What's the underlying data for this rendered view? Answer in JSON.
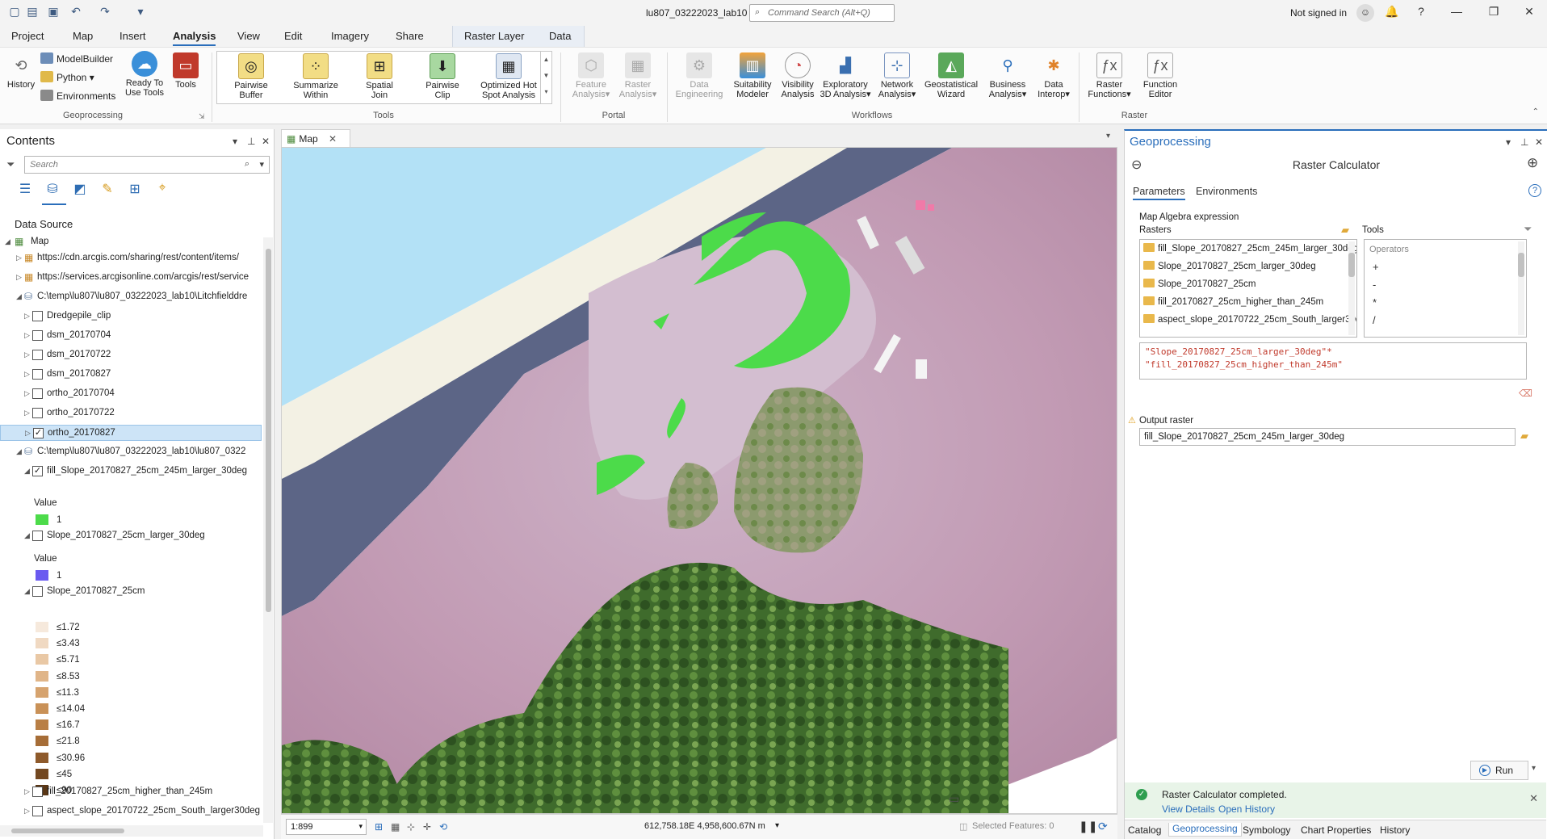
{
  "window": {
    "title": "lu807_03222023_lab10",
    "search_placeholder": "Command Search (Alt+Q)",
    "signin": "Not signed in"
  },
  "ribbon_tabs": [
    "Project",
    "Map",
    "Insert",
    "Analysis",
    "View",
    "Edit",
    "Imagery",
    "Share",
    "Raster Layer",
    "Data"
  ],
  "active_tab": "Analysis",
  "ribbon": {
    "history": "History",
    "modelbuilder": "ModelBuilder",
    "python": "Python",
    "environments": "Environments",
    "ready_to_use_1": "Ready To",
    "ready_to_use_2": "Use Tools",
    "tools": "Tools",
    "geoprocessing_group": "Geoprocessing",
    "gallery": [
      {
        "l1": "Pairwise",
        "l2": "Buffer"
      },
      {
        "l1": "Summarize",
        "l2": "Within"
      },
      {
        "l1": "Spatial",
        "l2": "Join"
      },
      {
        "l1": "Pairwise",
        "l2": "Clip"
      },
      {
        "l1": "Optimized Hot",
        "l2": "Spot Analysis"
      }
    ],
    "tools_group": "Tools",
    "portal": [
      {
        "l1": "Feature",
        "l2": "Analysis"
      },
      {
        "l1": "Raster",
        "l2": "Analysis"
      }
    ],
    "portal_group": "Portal",
    "workflows": [
      {
        "l1": "Data",
        "l2": "Engineering"
      },
      {
        "l1": "Suitability",
        "l2": "Modeler"
      },
      {
        "l1": "Visibility",
        "l2": "Analysis"
      },
      {
        "l1": "Exploratory",
        "l2": "3D Analysis"
      },
      {
        "l1": "Network",
        "l2": "Analysis"
      },
      {
        "l1": "Geostatistical",
        "l2": "Wizard"
      },
      {
        "l1": "Business",
        "l2": "Analysis"
      },
      {
        "l1": "Data",
        "l2": "Interop"
      }
    ],
    "workflows_group": "Workflows",
    "raster": [
      {
        "l1": "Raster",
        "l2": "Functions"
      },
      {
        "l1": "Function",
        "l2": "Editor"
      }
    ],
    "raster_group": "Raster"
  },
  "contents": {
    "title": "Contents",
    "search_placeholder": "Search",
    "data_source_label": "Data Source",
    "map": "Map",
    "items": [
      {
        "text": "https://cdn.arcgis.com/sharing/rest/content/items/"
      },
      {
        "text": "https://services.arcgisonline.com/arcgis/rest/service"
      },
      {
        "text": "C:\\temp\\lu807\\lu807_03222023_lab10\\Litchfielddre"
      },
      {
        "text": "Dredgepile_clip"
      },
      {
        "text": "dsm_20170704"
      },
      {
        "text": "dsm_20170722"
      },
      {
        "text": "dsm_20170827"
      },
      {
        "text": "ortho_20170704"
      },
      {
        "text": "ortho_20170722"
      },
      {
        "text": "ortho_20170827"
      },
      {
        "text": "C:\\temp\\lu807\\lu807_03222023_lab10\\lu807_0322"
      },
      {
        "text": "fill_Slope_20170827_25cm_245m_larger_30deg"
      },
      {
        "text": "Value"
      },
      {
        "text": "1"
      },
      {
        "text": "Slope_20170827_25cm_larger_30deg"
      },
      {
        "text": "Value"
      },
      {
        "text": "1"
      },
      {
        "text": "Slope_20170827_25cm"
      }
    ],
    "slope_legend": [
      "≤1.72",
      "≤3.43",
      "≤5.71",
      "≤8.53",
      "≤11.3",
      "≤14.04",
      "≤16.7",
      "≤21.8",
      "≤30.96",
      "≤45",
      "≤90"
    ],
    "slope_colors": [
      "#f6e9dc",
      "#f0d9c2",
      "#e9c8a5",
      "#e0b588",
      "#d6a36e",
      "#c99157",
      "#b97f45",
      "#a66d37",
      "#8e5a2b",
      "#734821",
      "#5a3716"
    ],
    "tail_items": [
      "fill_20170827_25cm_higher_than_245m",
      "aspect_slope_20170722_25cm_South_larger30deg"
    ],
    "value_green": "#4cdb4a",
    "value_blue": "#6a5af0"
  },
  "map": {
    "tab": "Map",
    "scale": "1:899",
    "coords": "612,758.18E 4,958,600.67N m",
    "selected_features": "Selected Features: 0"
  },
  "geo": {
    "title": "Geoprocessing",
    "tool": "Raster Calculator",
    "tab_parameters": "Parameters",
    "tab_environments": "Environments",
    "map_algebra_label": "Map Algebra expression",
    "rasters_label": "Rasters",
    "tools_label": "Tools",
    "rasters": [
      "fill_Slope_20170827_25cm_245m_larger_30deg",
      "Slope_20170827_25cm_larger_30deg",
      "Slope_20170827_25cm",
      "fill_20170827_25cm_higher_than_245m",
      "aspect_slope_20170722_25cm_South_larger30deg"
    ],
    "operators_label": "Operators",
    "operators": [
      "+",
      "-",
      "*",
      "/"
    ],
    "expr_line1": "\"Slope_20170827_25cm_larger_30deg\"*",
    "expr_line2": "\"fill_20170827_25cm_higher_than_245m\"",
    "output_label": "Output raster",
    "output_value": "fill_Slope_20170827_25cm_245m_larger_30deg",
    "run": "Run",
    "notice_msg": "Raster Calculator completed.",
    "view_details": "View Details",
    "open_history": "Open History",
    "bottom_tabs": [
      "Catalog",
      "Geoprocessing",
      "Symbology",
      "Chart Properties",
      "History"
    ]
  }
}
